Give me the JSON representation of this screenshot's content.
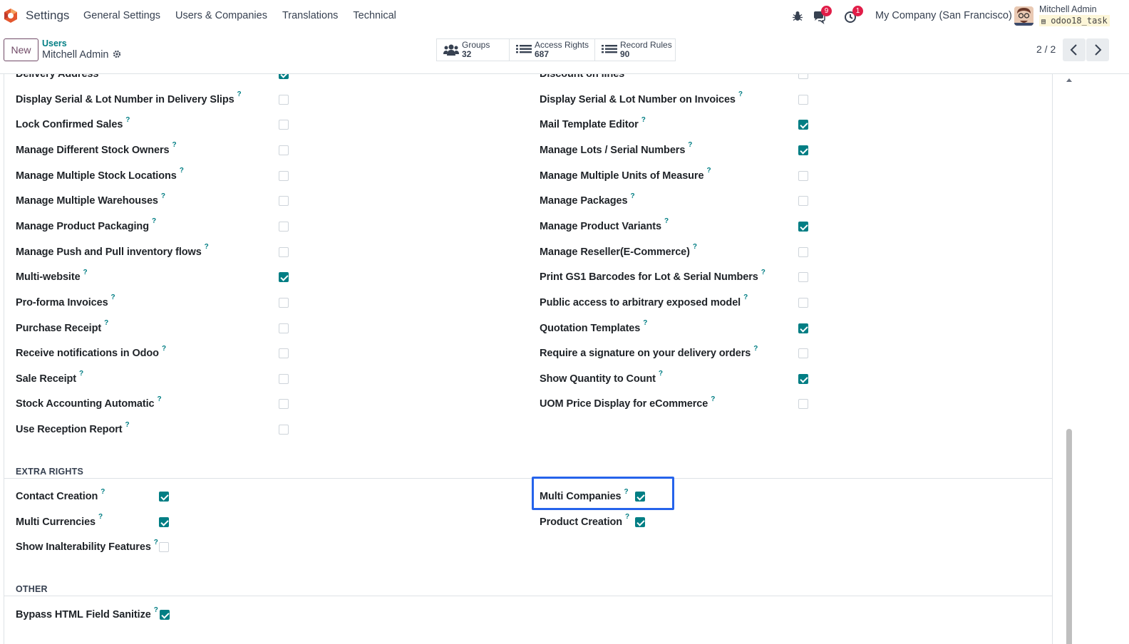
{
  "navbar": {
    "app_name": "Settings",
    "menu": [
      "General Settings",
      "Users & Companies",
      "Translations",
      "Technical"
    ],
    "messages_badge": "9",
    "activities_badge": "1",
    "company": "My Company (San Francisco)",
    "user_name": "Mitchell Admin",
    "database": "odoo18_task",
    "brand_color": "#714b67",
    "accent_color": "#017e84"
  },
  "control": {
    "new_label": "New",
    "breadcrumb_parent": "Users",
    "breadcrumb_current": "Mitchell Admin",
    "smart_buttons": [
      {
        "label": "Groups",
        "value": "32",
        "icon": "users-icon"
      },
      {
        "label": "Access Rights",
        "value": "687",
        "icon": "list-icon"
      },
      {
        "label": "Record Rules",
        "value": "90",
        "icon": "list-icon"
      }
    ],
    "pager": "2 / 2"
  },
  "technical": {
    "left": [
      {
        "label": "Delivery Address",
        "checked": true
      },
      {
        "label": "Display Serial & Lot Number in Delivery Slips",
        "checked": false
      },
      {
        "label": "Lock Confirmed Sales",
        "checked": false
      },
      {
        "label": "Manage Different Stock Owners",
        "checked": false
      },
      {
        "label": "Manage Multiple Stock Locations",
        "checked": false
      },
      {
        "label": "Manage Multiple Warehouses",
        "checked": false
      },
      {
        "label": "Manage Product Packaging",
        "checked": false
      },
      {
        "label": "Manage Push and Pull inventory flows",
        "checked": false
      },
      {
        "label": "Multi-website",
        "checked": true
      },
      {
        "label": "Pro-forma Invoices",
        "checked": false
      },
      {
        "label": "Purchase Receipt",
        "checked": false
      },
      {
        "label": "Receive notifications in Odoo",
        "checked": false
      },
      {
        "label": "Sale Receipt",
        "checked": false
      },
      {
        "label": "Stock Accounting Automatic",
        "checked": false
      },
      {
        "label": "Use Reception Report",
        "checked": false
      }
    ],
    "right": [
      {
        "label": "Discount on lines",
        "checked": false
      },
      {
        "label": "Display Serial & Lot Number on Invoices",
        "checked": false
      },
      {
        "label": "Mail Template Editor",
        "checked": true
      },
      {
        "label": "Manage Lots / Serial Numbers",
        "checked": true
      },
      {
        "label": "Manage Multiple Units of Measure",
        "checked": false
      },
      {
        "label": "Manage Packages",
        "checked": false
      },
      {
        "label": "Manage Product Variants",
        "checked": true
      },
      {
        "label": "Manage Reseller(E-Commerce)",
        "checked": false
      },
      {
        "label": "Print GS1 Barcodes for Lot & Serial Numbers",
        "checked": false
      },
      {
        "label": "Public access to arbitrary exposed model",
        "checked": false
      },
      {
        "label": "Quotation Templates",
        "checked": true
      },
      {
        "label": "Require a signature on your delivery orders",
        "checked": false
      },
      {
        "label": "Show Quantity to Count",
        "checked": true
      },
      {
        "label": "UOM Price Display for eCommerce",
        "checked": false
      }
    ]
  },
  "extra_rights": {
    "title": "EXTRA RIGHTS",
    "left": [
      {
        "label": "Contact Creation",
        "checked": true
      },
      {
        "label": "Multi Currencies",
        "checked": true
      },
      {
        "label": "Show Inalterability Features",
        "checked": false
      }
    ],
    "right": [
      {
        "label": "Multi Companies",
        "checked": true
      },
      {
        "label": "Product Creation",
        "checked": true
      }
    ]
  },
  "other": {
    "title": "OTHER",
    "items": [
      {
        "label": "Bypass HTML Field Sanitize",
        "checked": true
      }
    ]
  },
  "help_marker": "?"
}
